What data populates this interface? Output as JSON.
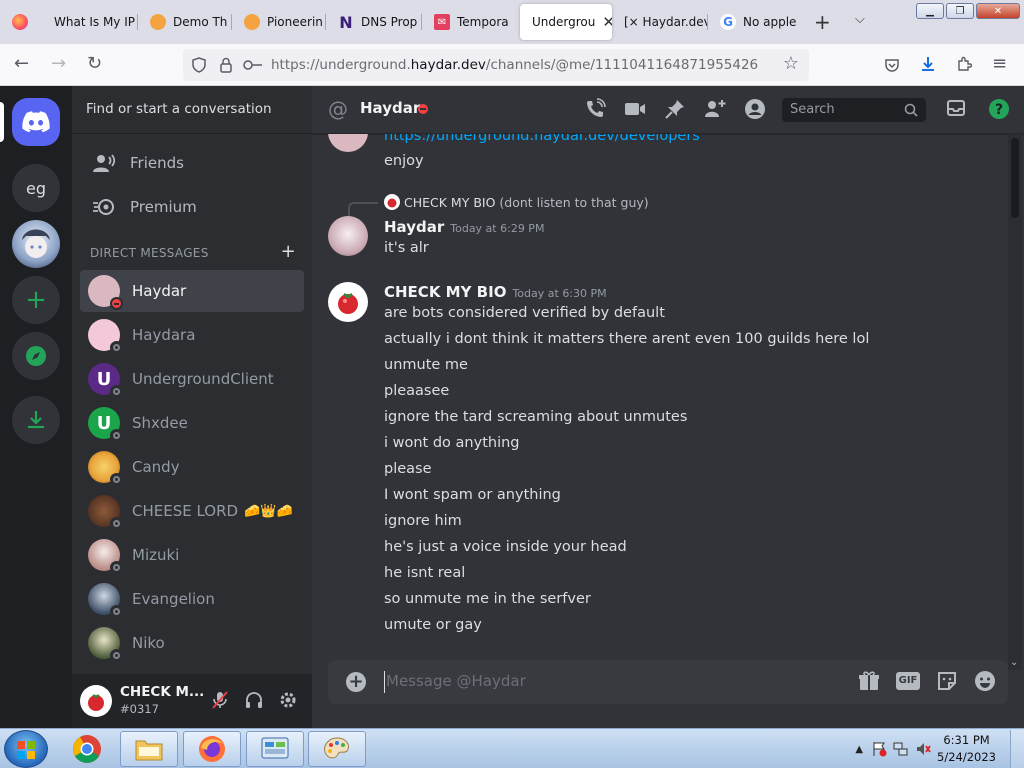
{
  "browser": {
    "tabs": [
      {
        "label": "What Is My IP",
        "active": false
      },
      {
        "label": "Demo Th",
        "active": false
      },
      {
        "label": "Pioneerin",
        "active": false
      },
      {
        "label": "DNS Prop",
        "active": false
      },
      {
        "label": "Tempora",
        "active": false
      },
      {
        "label": "Undergrou",
        "active": true
      },
      {
        "label": "[× Haydar.dev",
        "active": false
      },
      {
        "label": "No apple",
        "active": false
      }
    ],
    "url_prefix": "https://underground.",
    "url_domain": "haydar.dev",
    "url_path": "/channels/@me/1111041164871955426"
  },
  "discord": {
    "rail": {
      "server_eg": "eg"
    },
    "dm_search_placeholder": "Find or start a conversation",
    "nav": {
      "friends": "Friends",
      "premium": "Premium"
    },
    "dm_header": "DIRECT MESSAGES",
    "dm_list": [
      {
        "name": "Haydar",
        "status": "dnd",
        "selected": true,
        "color": "#d9b8c0"
      },
      {
        "name": "Haydara",
        "status": "offline",
        "selected": false,
        "color": "#f3c8d8"
      },
      {
        "name": "UndergroundClient",
        "status": "offline",
        "selected": false,
        "color": "#5b2a86"
      },
      {
        "name": "Shxdee",
        "status": "offline",
        "selected": false,
        "color": "#1aa54a"
      },
      {
        "name": "Candy",
        "status": "offline",
        "selected": false,
        "color": "#e8a23a"
      },
      {
        "name": "CHEESE LORD",
        "emoji": "🧀👑🧀",
        "status": "offline",
        "selected": false,
        "color": "#6b3a2a"
      },
      {
        "name": "Mizuki",
        "status": "offline",
        "selected": false,
        "color": "#d8c8c4"
      },
      {
        "name": "Evangelion",
        "status": "offline",
        "selected": false,
        "color": "#3d4f66"
      },
      {
        "name": "Niko",
        "status": "offline",
        "selected": false,
        "color": "#4d5d3a"
      }
    ],
    "user_panel": {
      "name": "CHECK M...",
      "tag": "#0317"
    },
    "chat": {
      "recipient": "Haydar",
      "search_placeholder": "Search",
      "top_link": "https://underground.haydar.dev/developers",
      "top_text": "enjoy",
      "reply_author": "CHECK MY BIO",
      "reply_text": "(dont listen to that guy)",
      "msg1": {
        "author": "Haydar",
        "timestamp": "Today at 6:29 PM",
        "lines": [
          "it's alr"
        ]
      },
      "msg2": {
        "author": "CHECK MY BIO",
        "timestamp": "Today at 6:30 PM",
        "lines": [
          "are bots considered verified by default",
          "actually i dont think it matters there arent even 100 guilds here lol",
          "unmute me",
          "pleaasee",
          "ignore the tard screaming about unmutes",
          "i wont do anything",
          "please",
          "I wont spam or anything",
          "ignore him",
          "he's just a voice inside your head",
          "he isnt real",
          "so unmute me in the serfver",
          "umute or gay"
        ]
      },
      "composer_placeholder": "Message @Haydar",
      "gif_label": "GIF"
    },
    "colors": {
      "blurple": "#5865f2",
      "green": "#23a559",
      "dnd_red": "#f23f43",
      "link": "#00a8fc"
    }
  },
  "taskbar": {
    "time": "6:31 PM",
    "date": "5/24/2023"
  }
}
